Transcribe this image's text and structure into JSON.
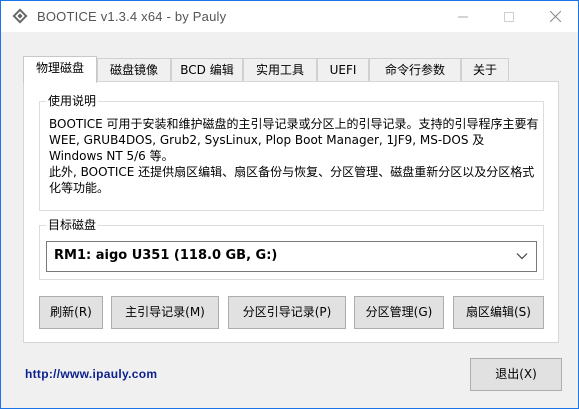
{
  "window": {
    "title": "BOOTICE v1.3.4 x64 - by Pauly",
    "app_icon": "diamond-icon",
    "accent_color": "#1a73e8"
  },
  "tabs": [
    {
      "label": "物理磁盘",
      "active": true
    },
    {
      "label": "磁盘镜像",
      "active": false
    },
    {
      "label": "BCD 编辑",
      "active": false
    },
    {
      "label": "实用工具",
      "active": false
    },
    {
      "label": "UEFI",
      "active": false
    },
    {
      "label": "命令行参数",
      "active": false
    },
    {
      "label": "关于",
      "active": false
    }
  ],
  "usage": {
    "title": "使用说明",
    "text": "BOOTICE 可用于安装和维护磁盘的主引导记录或分区上的引导记录。支持的引导程序主要有 WEE, GRUB4DOS, Grub2, SysLinux, Plop Boot Manager, 1JF9, MS-DOS 及 Windows NT 5/6 等。\n此外, BOOTICE 还提供扇区编辑、扇区备份与恢复、分区管理、磁盘重新分区以及分区格式化等功能。"
  },
  "disk": {
    "title": "目标磁盘",
    "selected": "RM1: aigo U351 (118.0 GB, G:)"
  },
  "buttons": {
    "refresh": "刷新(R)",
    "mbr": "主引导记录(M)",
    "pbr": "分区引导记录(P)",
    "parts": "分区管理(G)",
    "sector": "扇区编辑(S)",
    "exit": "退出(X)"
  },
  "link": "http://www.ipauly.com"
}
